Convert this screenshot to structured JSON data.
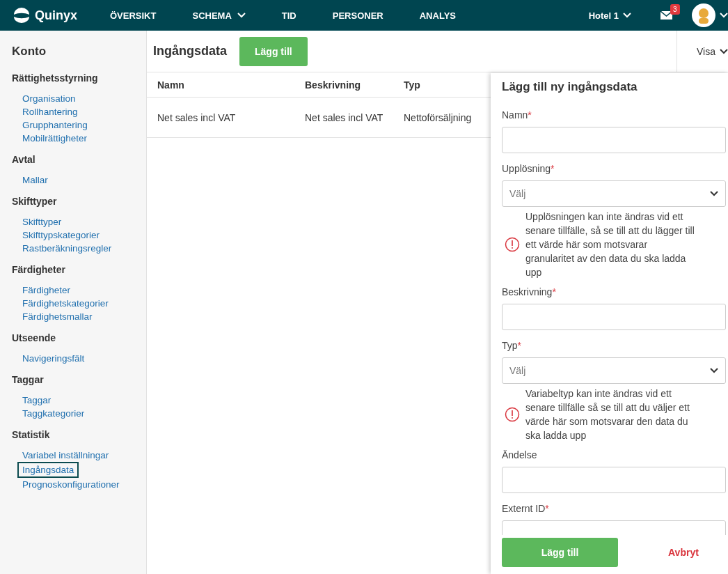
{
  "topbar": {
    "logo": "Quinyx",
    "nav": [
      {
        "label": "ÖVERSIKT",
        "dropdown": false
      },
      {
        "label": "SCHEMA",
        "dropdown": true
      },
      {
        "label": "TID",
        "dropdown": false
      },
      {
        "label": "PERSONER",
        "dropdown": false
      },
      {
        "label": "ANALYS",
        "dropdown": false
      }
    ],
    "unit": "Hotel 1",
    "mail_badge": "3"
  },
  "sidebar": {
    "title": "Konto",
    "groups": [
      {
        "title": "Rättighetsstyrning",
        "items": [
          {
            "label": "Organisation",
            "selected": false
          },
          {
            "label": "Rollhantering",
            "selected": false
          },
          {
            "label": "Grupphantering",
            "selected": false
          },
          {
            "label": "Mobilrättigheter",
            "selected": false
          }
        ]
      },
      {
        "title": "Avtal",
        "items": [
          {
            "label": "Mallar",
            "selected": false
          }
        ]
      },
      {
        "title": "Skifttyper",
        "items": [
          {
            "label": "Skifttyper",
            "selected": false
          },
          {
            "label": "Skifttypskategorier",
            "selected": false
          },
          {
            "label": "Rastberäkningsregler",
            "selected": false
          }
        ]
      },
      {
        "title": "Färdigheter",
        "items": [
          {
            "label": "Färdigheter",
            "selected": false
          },
          {
            "label": "Färdighetskategorier",
            "selected": false
          },
          {
            "label": "Färdighetsmallar",
            "selected": false
          }
        ]
      },
      {
        "title": "Utseende",
        "items": [
          {
            "label": "Navigeringsfält",
            "selected": false
          }
        ]
      },
      {
        "title": "Taggar",
        "items": [
          {
            "label": "Taggar",
            "selected": false
          },
          {
            "label": "Taggkategorier",
            "selected": false
          }
        ]
      },
      {
        "title": "Statistik",
        "items": [
          {
            "label": "Variabel inställningar",
            "selected": false
          },
          {
            "label": "Ingångsdata",
            "selected": true
          },
          {
            "label": "Prognoskonfigurationer",
            "selected": false
          }
        ]
      }
    ]
  },
  "header": {
    "title": "Ingångsdata",
    "add_button": "Lägg till",
    "view_menu": "Visa"
  },
  "table": {
    "columns": [
      "Namn",
      "Beskrivning",
      "Typ"
    ],
    "rows": [
      [
        "Net sales incl VAT",
        "Net sales incl VAT",
        "Nettoförsäljning"
      ]
    ]
  },
  "panel": {
    "title": "Lägg till ny ingångsdata",
    "fields": [
      {
        "kind": "text",
        "label": "Namn",
        "required_mark": "*"
      },
      {
        "kind": "select",
        "label": "Upplösning",
        "required_mark": "*",
        "placeholder": "Välj",
        "hint": "Upplösningen kan inte ändras vid ett senare tillfälle, så se till att du lägger till ett värde här som motsvarar granularitet av den data du ska ladda upp"
      },
      {
        "kind": "text",
        "label": "Beskrivning",
        "required_mark": "*"
      },
      {
        "kind": "select",
        "label": "Typ",
        "required_mark": "*",
        "placeholder": "Välj",
        "hint": "Variabeltyp kan inte ändras vid ett senare tillfälle så se till att du väljer ett värde här som motsvarar den data du ska ladda upp"
      },
      {
        "kind": "text",
        "label": "Ändelse"
      },
      {
        "kind": "text",
        "label": "Externt ID",
        "required_mark": "*"
      }
    ],
    "submit": "Lägg till",
    "cancel": "Avbryt"
  }
}
